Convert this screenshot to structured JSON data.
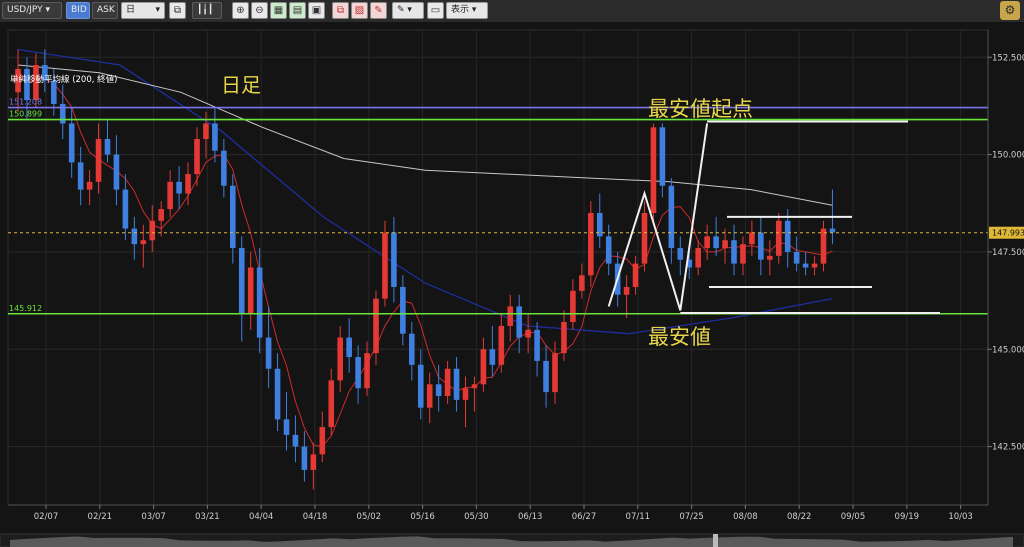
{
  "toolbar": {
    "symbol": "USD/JPY",
    "bid_label": "BID",
    "ask_label": "ASK",
    "timeframe": "日",
    "display_label": "表示"
  },
  "colors": {
    "up_candle": "#e53935",
    "down_candle": "#3f7fe0",
    "background": "#141414",
    "sma_short": "#d02a2a",
    "sma_mid": "#1e2e9e",
    "sma_long": "#c8c8c8",
    "level_green": "#69e43a",
    "level_purple": "#7b74e8",
    "current_price": "#e0b838"
  },
  "chart_data": {
    "type": "candlestick",
    "symbol": "USD/JPY",
    "timeframe": "日",
    "x_tick_labels": [
      "02/07",
      "02/21",
      "03/07",
      "03/21",
      "04/04",
      "04/18",
      "05/02",
      "05/16",
      "05/30",
      "06/13",
      "06/27",
      "07/11",
      "07/25",
      "08/08",
      "08/22",
      "09/05",
      "09/19",
      "10/03"
    ],
    "y_tick_labels": [
      "152.500",
      "150.000",
      "147.500",
      "145.000",
      "142.500"
    ],
    "y_ticks": [
      152.5,
      150.0,
      147.5,
      145.0,
      142.5
    ],
    "ylim": [
      141.0,
      153.2
    ],
    "candles_ohlc": [
      [
        151.6,
        152.7,
        151.1,
        152.2
      ],
      [
        152.2,
        152.5,
        150.9,
        151.4
      ],
      [
        151.4,
        152.6,
        151.2,
        152.3
      ],
      [
        152.3,
        152.7,
        151.6,
        151.9
      ],
      [
        151.9,
        152.2,
        151.0,
        151.3
      ],
      [
        151.3,
        151.8,
        150.4,
        150.8
      ],
      [
        150.8,
        151.2,
        149.4,
        149.8
      ],
      [
        149.8,
        150.2,
        148.7,
        149.1
      ],
      [
        149.1,
        149.6,
        148.7,
        149.3
      ],
      [
        149.3,
        150.8,
        149.0,
        150.4
      ],
      [
        150.4,
        150.9,
        149.8,
        150.0
      ],
      [
        150.0,
        150.5,
        148.7,
        149.1
      ],
      [
        149.1,
        149.5,
        147.8,
        148.1
      ],
      [
        148.1,
        148.4,
        147.3,
        147.7
      ],
      [
        147.7,
        148.2,
        147.1,
        147.8
      ],
      [
        147.8,
        148.7,
        147.5,
        148.3
      ],
      [
        148.3,
        148.8,
        147.9,
        148.6
      ],
      [
        148.6,
        149.6,
        148.4,
        149.3
      ],
      [
        149.3,
        149.7,
        148.6,
        149.0
      ],
      [
        149.0,
        149.8,
        148.7,
        149.5
      ],
      [
        149.5,
        150.7,
        149.2,
        150.4
      ],
      [
        150.4,
        151.1,
        149.9,
        150.8
      ],
      [
        150.8,
        151.2,
        149.8,
        150.1
      ],
      [
        150.1,
        150.4,
        148.9,
        149.2
      ],
      [
        149.2,
        149.5,
        147.2,
        147.6
      ],
      [
        147.6,
        147.9,
        145.2,
        145.9
      ],
      [
        145.9,
        147.5,
        145.5,
        147.1
      ],
      [
        147.1,
        147.6,
        144.9,
        145.3
      ],
      [
        145.3,
        146.1,
        144.0,
        144.5
      ],
      [
        144.5,
        144.9,
        142.9,
        143.2
      ],
      [
        143.2,
        143.9,
        142.4,
        142.8
      ],
      [
        142.8,
        143.3,
        142.1,
        142.5
      ],
      [
        142.5,
        142.9,
        141.6,
        141.9
      ],
      [
        141.9,
        142.6,
        141.4,
        142.3
      ],
      [
        142.3,
        143.4,
        142.1,
        143.0
      ],
      [
        143.0,
        144.5,
        142.8,
        144.2
      ],
      [
        144.2,
        145.6,
        143.9,
        145.3
      ],
      [
        145.3,
        145.8,
        144.4,
        144.8
      ],
      [
        144.8,
        145.1,
        143.6,
        144.0
      ],
      [
        144.0,
        145.2,
        143.8,
        144.9
      ],
      [
        144.9,
        146.5,
        144.6,
        146.3
      ],
      [
        146.3,
        148.3,
        146.1,
        148.0
      ],
      [
        148.0,
        148.4,
        146.2,
        146.6
      ],
      [
        146.6,
        146.9,
        145.1,
        145.4
      ],
      [
        145.4,
        145.7,
        144.2,
        144.6
      ],
      [
        144.6,
        145.0,
        143.2,
        143.5
      ],
      [
        143.5,
        144.4,
        143.1,
        144.1
      ],
      [
        144.1,
        144.6,
        143.4,
        143.8
      ],
      [
        143.8,
        144.7,
        143.6,
        144.5
      ],
      [
        144.5,
        144.8,
        143.4,
        143.7
      ],
      [
        143.7,
        144.3,
        143.0,
        144.0
      ],
      [
        144.0,
        144.3,
        143.4,
        144.1
      ],
      [
        144.1,
        145.3,
        143.9,
        145.0
      ],
      [
        145.0,
        145.6,
        144.3,
        144.6
      ],
      [
        144.6,
        145.9,
        144.4,
        145.6
      ],
      [
        145.6,
        146.4,
        145.2,
        146.1
      ],
      [
        146.1,
        146.4,
        144.9,
        145.3
      ],
      [
        145.3,
        145.9,
        144.9,
        145.5
      ],
      [
        145.5,
        145.7,
        144.3,
        144.7
      ],
      [
        144.7,
        145.1,
        143.5,
        143.9
      ],
      [
        143.9,
        145.2,
        143.6,
        144.9
      ],
      [
        144.9,
        146.0,
        144.7,
        145.7
      ],
      [
        145.7,
        146.8,
        145.5,
        146.5
      ],
      [
        146.5,
        147.2,
        146.3,
        146.9
      ],
      [
        146.9,
        148.8,
        146.6,
        148.5
      ],
      [
        148.5,
        149.0,
        147.6,
        147.9
      ],
      [
        147.9,
        148.2,
        146.9,
        147.2
      ],
      [
        147.2,
        147.5,
        146.1,
        146.4
      ],
      [
        146.4,
        146.9,
        145.8,
        146.6
      ],
      [
        146.6,
        147.4,
        146.4,
        147.2
      ],
      [
        147.2,
        148.8,
        147.0,
        148.5
      ],
      [
        148.5,
        150.8,
        148.3,
        150.7
      ],
      [
        150.7,
        150.8,
        148.9,
        149.2
      ],
      [
        149.2,
        149.4,
        147.2,
        147.6
      ],
      [
        147.6,
        147.9,
        146.9,
        147.3
      ],
      [
        147.3,
        147.6,
        146.8,
        147.1
      ],
      [
        147.1,
        147.8,
        146.9,
        147.6
      ],
      [
        147.6,
        148.2,
        147.3,
        147.9
      ],
      [
        147.9,
        148.4,
        147.4,
        147.6
      ],
      [
        147.6,
        148.1,
        147.2,
        147.8
      ],
      [
        147.8,
        148.2,
        146.9,
        147.2
      ],
      [
        147.2,
        147.9,
        146.9,
        147.7
      ],
      [
        147.7,
        148.3,
        147.4,
        148.0
      ],
      [
        148.0,
        148.4,
        146.9,
        147.3
      ],
      [
        147.3,
        147.8,
        146.9,
        147.4
      ],
      [
        147.4,
        148.5,
        147.2,
        148.3
      ],
      [
        148.3,
        148.6,
        147.1,
        147.5
      ],
      [
        147.5,
        147.9,
        147.0,
        147.2
      ],
      [
        147.2,
        147.5,
        146.9,
        147.1
      ],
      [
        147.1,
        147.4,
        146.9,
        147.2
      ],
      [
        147.2,
        148.3,
        147.0,
        148.1
      ],
      [
        148.1,
        149.1,
        147.7,
        148.0
      ]
    ],
    "current_price": 147.993,
    "current_price_label": "147.993",
    "indicator_legend": [
      {
        "name": "単純移動平均線 (200, 終値)",
        "color": "#ffffff"
      }
    ],
    "horizontal_levels": [
      {
        "value": 151.208,
        "label": "151.208",
        "color": "#7b74e8"
      },
      {
        "value": 150.899,
        "label": "150.899",
        "color": "#69e43a"
      },
      {
        "value": 145.912,
        "label": "145.912",
        "color": "#69e43a"
      }
    ],
    "annotations": [
      {
        "text": "日足",
        "color": "#e8d64a"
      },
      {
        "text": "最安値起点",
        "color": "#e8d64a"
      },
      {
        "text": "最安値",
        "color": "#e8d64a"
      }
    ],
    "grid": true
  }
}
